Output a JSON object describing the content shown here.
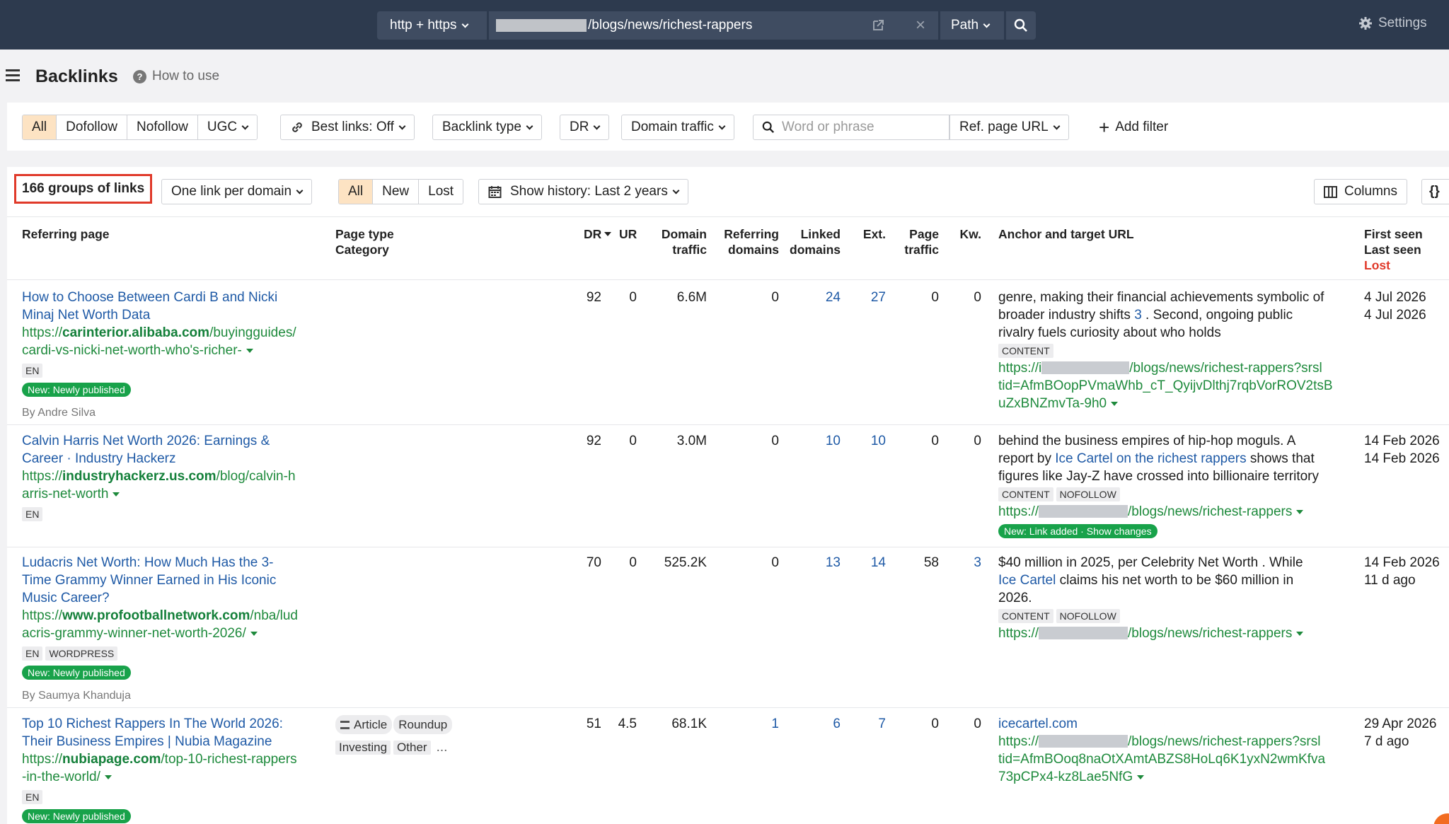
{
  "topbar": {
    "protocol": "http + https",
    "url_suffix": "/blogs/news/richest-rappers",
    "path_label": "Path",
    "settings_label": "Settings"
  },
  "header": {
    "title": "Backlinks",
    "how_to_use": "How to use"
  },
  "filters": {
    "link_types": [
      "All",
      "Dofollow",
      "Nofollow",
      "UGC"
    ],
    "best_links": "Best links: Off",
    "backlink_type": "Backlink type",
    "dr": "DR",
    "domain_traffic": "Domain traffic",
    "search_placeholder": "Word or phrase",
    "ref_page_url": "Ref. page URL",
    "add_filter": "Add filter"
  },
  "toolbar": {
    "groups_count": "166 groups of links",
    "grouping": "One link per domain",
    "status_tabs": [
      "All",
      "New",
      "Lost"
    ],
    "history": "Show history: Last 2 years",
    "columns": "Columns",
    "export_icon_text": "{}"
  },
  "columns": {
    "referring_page": "Referring page",
    "page_type": "Page type",
    "category": "Category",
    "dr": "DR",
    "ur": "UR",
    "domain_traffic_1": "Domain",
    "domain_traffic_2": "traffic",
    "referring_domains_1": "Referring",
    "referring_domains_2": "domains",
    "linked_domains_1": "Linked",
    "linked_domains_2": "domains",
    "ext": "Ext.",
    "page_traffic_1": "Page",
    "page_traffic_2": "traffic",
    "kw": "Kw.",
    "anchor": "Anchor and target URL",
    "first_seen": "First seen",
    "last_seen": "Last seen",
    "lost": "Lost"
  },
  "rows": [
    {
      "title": "How to Choose Between Cardi B and Nicki Minaj Net Worth Data",
      "url_prefix": "https://",
      "url_domain": "carinterior.alibaba.com",
      "url_path_1": "/buyingguides/",
      "url_path_2": "cardi-vs-nicki-net-worth-who's-richer-",
      "tags": [
        "EN"
      ],
      "badge": "New: Newly published",
      "byline": "By Andre Silva",
      "dr": "92",
      "ur": "0",
      "domain_traffic": "6.6M",
      "ref_domains": "0",
      "linked_domains": "24",
      "ext": "27",
      "page_traffic": "0",
      "kw": "0",
      "anchor_1": "genre, making their financial achievements symbolic of",
      "anchor_2a": "broader industry shifts ",
      "anchor_2link": "3",
      "anchor_2b": " . Second, ongoing public",
      "anchor_3": "rivalry fuels curiosity about who holds",
      "anchor_tags": [
        "CONTENT"
      ],
      "target_1a": "https://i",
      "target_1b": "/blogs/news/richest-rappers?srsl",
      "target_2": "tid=AfmBOopPVmaWhb_cT_QyijvDlthj7rqbVorROV2tsB",
      "target_3": "uZxBNZmvTa-9h0",
      "first_seen": "4 Jul 2026",
      "last_seen": "4 Jul 2026"
    },
    {
      "title_1": "Calvin Harris Net Worth 2026: Earnings &",
      "title_2": "Career · Industry Hackerz",
      "url_prefix": "https://",
      "url_domain": "industryhackerz.us.com",
      "url_path_1": "/blog/calvin-h",
      "url_path_2": "arris-net-worth",
      "tags": [
        "EN"
      ],
      "dr": "92",
      "ur": "0",
      "domain_traffic": "3.0M",
      "ref_domains": "0",
      "linked_domains": "10",
      "ext": "10",
      "page_traffic": "0",
      "kw": "0",
      "anchor_1": "behind the business empires of hip-hop moguls. A",
      "anchor_2a": "report by ",
      "anchor_2link": "Ice Cartel on the richest rappers",
      "anchor_2b": " shows that",
      "anchor_3": "figures like Jay-Z have crossed into billionaire territory",
      "anchor_tags": [
        "CONTENT",
        "NOFOLLOW"
      ],
      "target_prefix": "https://",
      "target_suffix": "/blogs/news/richest-rappers",
      "link_badge": "New: Link added",
      "link_badge_action": "Show changes",
      "first_seen": "14 Feb 2026",
      "last_seen": "14 Feb 2026"
    },
    {
      "title_1": "Ludacris Net Worth: How Much Has the 3-",
      "title_2": "Time Grammy Winner Earned in His Iconic",
      "title_3": "Music Career?",
      "url_prefix": "https://",
      "url_domain": "www.profootballnetwork.com",
      "url_path_1": "/nba/lud",
      "url_path_2": "acris-grammy-winner-net-worth-2026/",
      "tags": [
        "EN",
        "WORDPRESS"
      ],
      "badge": "New: Newly published",
      "byline": "By Saumya Khanduja",
      "dr": "70",
      "ur": "0",
      "domain_traffic": "525.2K",
      "ref_domains": "0",
      "linked_domains": "13",
      "ext": "14",
      "page_traffic": "58",
      "kw": "3",
      "anchor_1": "$40 million in 2025, per Celebrity Net Worth . While",
      "anchor_2link": "Ice Cartel",
      "anchor_2b": " claims his net worth to be $60 million in",
      "anchor_3": "2026.",
      "anchor_tags": [
        "CONTENT",
        "NOFOLLOW"
      ],
      "target_prefix": "https://",
      "target_suffix": "/blogs/news/richest-rappers",
      "first_seen": "14 Feb 2026",
      "last_seen": "11 d ago"
    },
    {
      "title_1": "Top 10 Richest Rappers In The World 2026:",
      "title_2": "Their Business Empires | Nubia Magazine",
      "url_prefix": "https://",
      "url_domain": "nubiapage.com",
      "url_path_1": "/top-10-richest-rappers",
      "url_path_2": "-in-the-world/",
      "tags": [
        "EN"
      ],
      "badge": "New: Newly published",
      "page_types": [
        "Article",
        "Roundup"
      ],
      "categories": [
        "Investing",
        "Other"
      ],
      "more": "...",
      "dr": "51",
      "ur": "4.5",
      "domain_traffic": "68.1K",
      "ref_domains": "1",
      "linked_domains": "6",
      "ext": "7",
      "page_traffic": "0",
      "kw": "0",
      "anchor_1": "icecartel.com",
      "target_prefix": "https://",
      "target_1b": "/blogs/news/richest-rappers?srsl",
      "target_2": "tid=AfmBOoq8naOtXAmtABZS8HoLq6K1yxN2wmKfva",
      "target_3": "73pCPx4-kz8Lae5NfG",
      "first_seen": "29 Apr 2026",
      "last_seen": "7 d ago"
    }
  ],
  "colors": {
    "topbar": "#2d3a4e",
    "accent_orange": "#fde3c3",
    "link_blue": "#1f5aa6",
    "url_green": "#1e8a3c",
    "highlight_red": "#e03a2a",
    "badge_green": "#18a24a"
  }
}
